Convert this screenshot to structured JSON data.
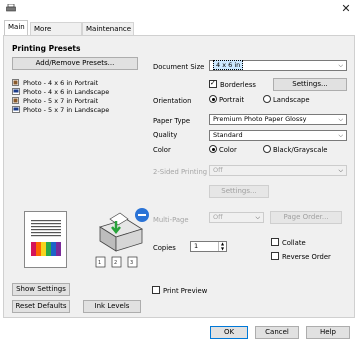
{
  "tabs": [
    {
      "label": "Main"
    },
    {
      "label": "More Options"
    },
    {
      "label": "Maintenance"
    }
  ],
  "presets": {
    "title": "Printing Presets",
    "add_button": "Add/Remove Presets...",
    "items": [
      {
        "label": "Photo - 4 x 6 in Portrait"
      },
      {
        "label": "Photo - 4 x 6 in Landscape"
      },
      {
        "label": "Photo - 5 x 7 in Portrait"
      },
      {
        "label": "Photo - 5 x 7 in Landscape"
      }
    ]
  },
  "settings": {
    "document_size_label": "Document Size",
    "document_size_value": "4 x 6 in",
    "borderless_label": "Borderless",
    "borderless_checked": true,
    "settings_button": "Settings...",
    "orientation_label": "Orientation",
    "portrait_label": "Portrait",
    "landscape_label": "Landscape",
    "paper_type_label": "Paper Type",
    "paper_type_value": "Premium Photo Paper Glossy",
    "quality_label": "Quality",
    "quality_value": "Standard",
    "color_label": "Color",
    "color_option": "Color",
    "bw_option": "Black/Grayscale",
    "two_sided_label": "2-Sided Printing",
    "two_sided_value": "Off",
    "two_sided_settings": "Settings...",
    "multi_page_label": "Multi-Page",
    "multi_page_value": "Off",
    "page_order_button": "Page Order...",
    "copies_label": "Copies",
    "copies_value": "1",
    "collate_label": "Collate",
    "reverse_order_label": "Reverse Order",
    "print_preview_label": "Print Preview"
  },
  "left_buttons": {
    "show_settings": "Show Settings",
    "reset_defaults": "Reset Defaults",
    "ink_levels": "Ink Levels"
  },
  "footer": {
    "ok": "OK",
    "cancel": "Cancel",
    "help": "Help"
  },
  "colors": {
    "accent": "#0078d7",
    "panel": "#f0f0f0",
    "selection": "#cce8ff"
  }
}
